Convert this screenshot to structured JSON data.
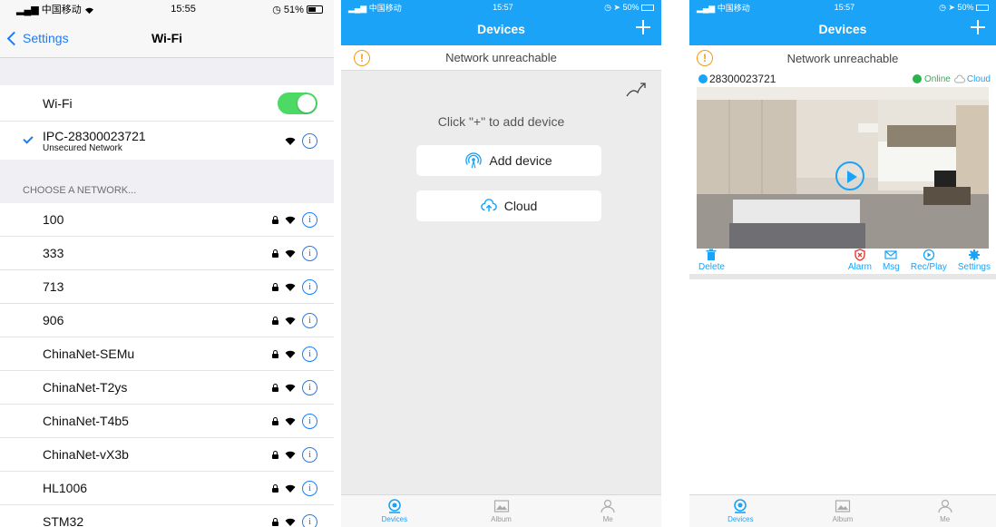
{
  "wifi_settings": {
    "status": {
      "carrier": "中国移动",
      "time": "15:55",
      "battery": "51%"
    },
    "nav": {
      "back_label": "Settings",
      "title": "Wi-Fi"
    },
    "wifi_label": "Wi-Fi",
    "wifi_enabled": true,
    "connected": {
      "ssid": "IPC-28300023721",
      "subtitle": "Unsecured Network"
    },
    "section_header": "CHOOSE A NETWORK...",
    "networks": [
      {
        "name": "100"
      },
      {
        "name": "333"
      },
      {
        "name": "713"
      },
      {
        "name": "906"
      },
      {
        "name": "ChinaNet-SEMu"
      },
      {
        "name": "ChinaNet-T2ys"
      },
      {
        "name": "ChinaNet-T4b5"
      },
      {
        "name": "ChinaNet-vX3b"
      },
      {
        "name": "HL1006"
      },
      {
        "name": "STM32"
      }
    ],
    "info_glyph": "i"
  },
  "devices_empty": {
    "status": {
      "carrier": "中国移动",
      "time": "15:57",
      "battery": "50%"
    },
    "title": "Devices",
    "warning": "Network unreachable",
    "warning_glyph": "!",
    "hint": "Click \"+\" to add device",
    "add_device_label": "Add device",
    "cloud_label": "Cloud"
  },
  "devices_list": {
    "status": {
      "carrier": "中国移动",
      "time": "15:57",
      "battery": "50%"
    },
    "title": "Devices",
    "warning": "Network unreachable",
    "warning_glyph": "!",
    "device": {
      "id": "28300023721",
      "online_label": "Online",
      "cloud_label": "Cloud"
    },
    "actions": {
      "delete": "Delete",
      "alarm": "Alarm",
      "msg": "Msg",
      "recplay": "Rec/Play",
      "settings": "Settings"
    }
  },
  "tabs": {
    "devices": "Devices",
    "album": "Album",
    "me": "Me"
  },
  "colors": {
    "accent": "#1aa3f7",
    "ios_blue": "#1c7cf4",
    "toggle_on": "#4cd964",
    "warning": "#f59a12",
    "online": "#2bb34a"
  }
}
